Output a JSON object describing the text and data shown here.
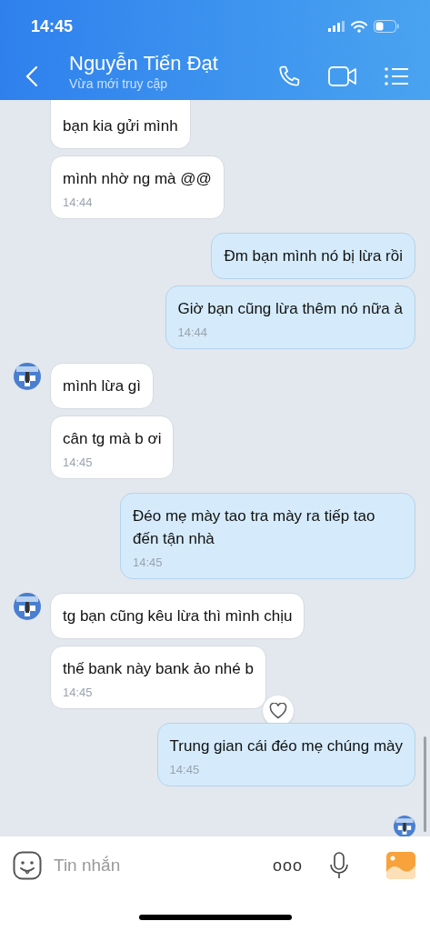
{
  "status_bar": {
    "time": "14:45"
  },
  "header": {
    "title": "Nguyễn Tiến Đạt",
    "subtitle": "Vừa mới truy cập"
  },
  "messages": [
    {
      "kind": "received",
      "text": "bạn kia gửi mình",
      "avatar": false,
      "reaction_button": false
    },
    {
      "kind": "received",
      "text": "mình nhờ ng mà @@",
      "time": "14:44",
      "avatar": false,
      "reaction_button": false
    },
    {
      "kind": "sent",
      "text": "Đm bạn mình nó bị lừa rồi",
      "avatar": false,
      "reaction_button": false
    },
    {
      "kind": "sent",
      "text": "Giờ bạn cũng lừa thêm nó nữa à",
      "time": "14:44",
      "avatar": false,
      "reaction_button": false
    },
    {
      "kind": "received",
      "text": "mình lừa gì",
      "avatar": true,
      "reaction_button": false
    },
    {
      "kind": "received",
      "text": "cân tg mà b ơi",
      "time": "14:45",
      "avatar": false,
      "reaction_button": false
    },
    {
      "kind": "sent",
      "text": "Đéo mẹ mày tao tra mày ra tiếp tao đến tận nhà",
      "time": "14:45",
      "avatar": false,
      "reaction_button": false
    },
    {
      "kind": "received",
      "text": "tg bạn cũng kêu lừa thì mình chịu",
      "avatar": true,
      "reaction_button": false
    },
    {
      "kind": "received",
      "text": "thế bank này bank ảo nhé b",
      "time": "14:45",
      "avatar": false,
      "reaction_button": true
    },
    {
      "kind": "sent",
      "text": "Trung gian cái đéo mẹ chúng mày",
      "time": "14:45",
      "avatar": false,
      "reaction_button": false
    }
  ],
  "composer": {
    "placeholder": "Tin nhắn",
    "more_label": "ooo"
  }
}
